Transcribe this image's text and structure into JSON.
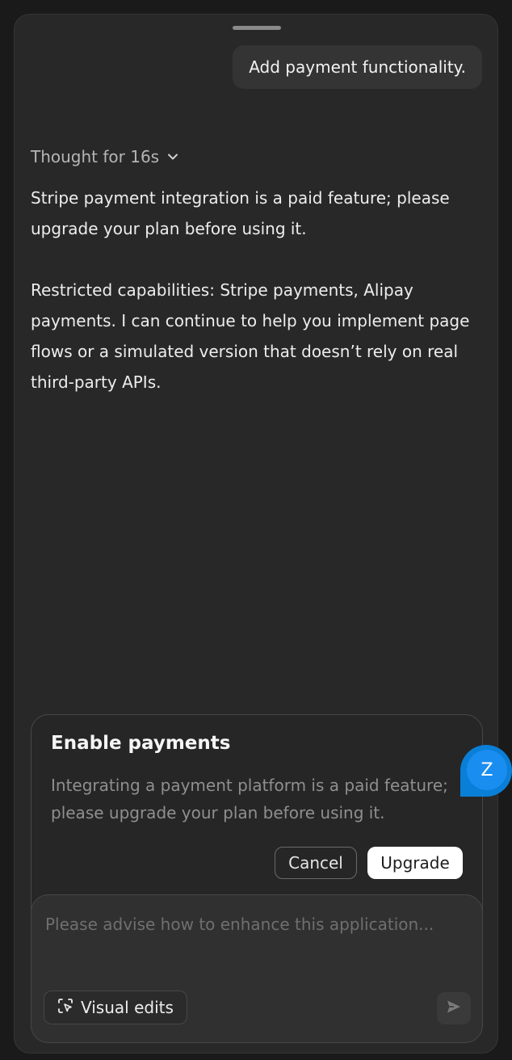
{
  "chat": {
    "user_message": "Add payment functionality.",
    "thought_label": "Thought for 16s",
    "answer_p1": "Stripe payment integration is a paid feature; please upgrade your plan before using it.",
    "answer_p2": "Restricted capabilities: Stripe payments, Alipay payments. I can continue to help you implement page flows or a simulated version that doesn’t rely on real third-party APIs."
  },
  "card": {
    "title": "Enable payments",
    "description": "Integrating a payment platform is a paid feature; please upgrade your plan before using it.",
    "cancel_label": "Cancel",
    "upgrade_label": "Upgrade"
  },
  "composer": {
    "placeholder": "Please advise how to enhance this application...",
    "visual_edits_label": "Visual edits"
  },
  "floating_avatar": {
    "letter": "Z"
  },
  "icons": {
    "thought_toggle": "chevron-down-icon",
    "visual_edits": "visual-edit-icon",
    "send": "send-icon"
  },
  "colors": {
    "background": "#282828",
    "accent": "#1a8df0",
    "upgrade_button": "#ffffff"
  }
}
